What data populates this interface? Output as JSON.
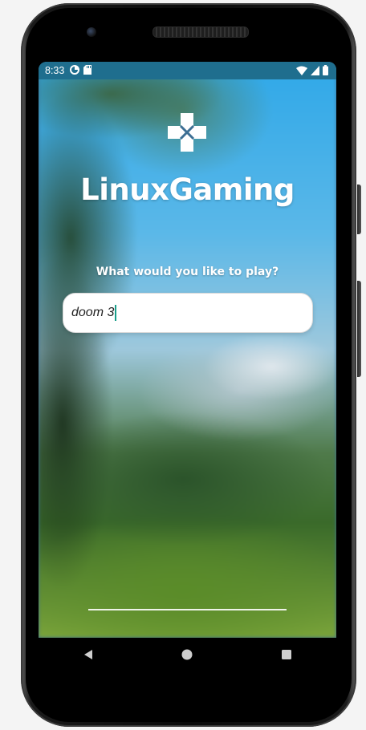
{
  "status_bar": {
    "time": "8:33",
    "left_icons": [
      "data-saver-icon",
      "sd-card-icon"
    ],
    "right_icons": [
      "wifi-icon",
      "cell-signal-icon",
      "battery-icon"
    ]
  },
  "app": {
    "logo_icon": "gamepad-dpad-icon",
    "title": "LinuxGaming",
    "prompt": "What would you like to play?"
  },
  "search": {
    "value": "doom 3",
    "caret_color": "#1a9e8a"
  },
  "nav_bar": {
    "buttons": [
      "back-icon",
      "home-icon",
      "recents-icon"
    ]
  },
  "colors": {
    "status_bar_bg": "#1f6e8e",
    "title_text": "#ffffff",
    "input_bg": "#ffffff"
  }
}
